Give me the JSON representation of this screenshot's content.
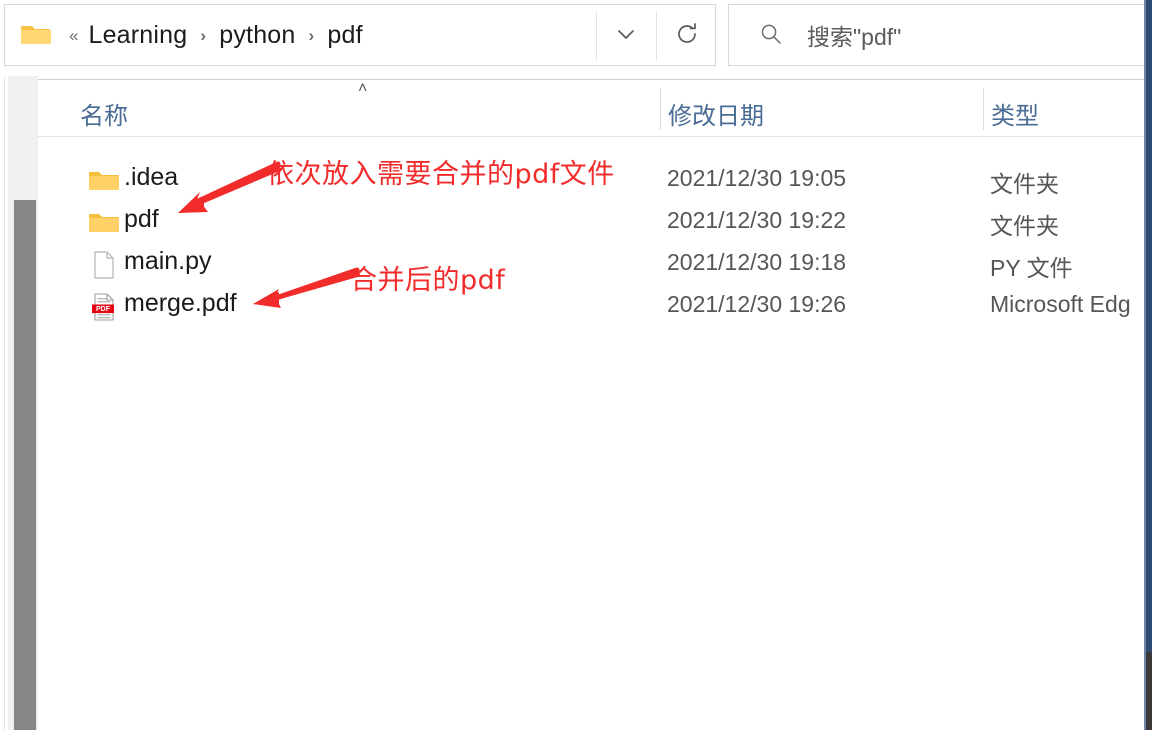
{
  "window": {
    "type": "file-explorer",
    "accent_color": "#2c4a72",
    "annotation_color": "#f22b2b"
  },
  "toolbar": {
    "folder_icon": "folder-icon",
    "overflow_symbol": "«",
    "breadcrumbs": [
      {
        "label": "Learning"
      },
      {
        "label": "python"
      },
      {
        "label": "pdf"
      }
    ],
    "breadcrumb_separator": "›",
    "dropdown_icon": "chevron-down-icon",
    "refresh_icon": "refresh-icon"
  },
  "search": {
    "icon": "search-icon",
    "placeholder": "搜索\"pdf\"",
    "value": ""
  },
  "columns": {
    "name": "名称",
    "date_modified": "修改日期",
    "type": "类型",
    "sort_indicator": "˄"
  },
  "files": [
    {
      "name": ".idea",
      "icon": "folder-icon",
      "date_modified": "2021/12/30 19:05",
      "type": "文件夹"
    },
    {
      "name": "pdf",
      "icon": "folder-icon",
      "date_modified": "2021/12/30 19:22",
      "type": "文件夹"
    },
    {
      "name": "main.py",
      "icon": "file-icon",
      "date_modified": "2021/12/30 19:18",
      "type": "PY 文件"
    },
    {
      "name": "merge.pdf",
      "icon": "pdf-file-icon",
      "date_modified": "2021/12/30 19:26",
      "type": "Microsoft Edg"
    }
  ],
  "annotations": [
    {
      "text": "依次放入需要合并的pdf文件",
      "points_to": "pdf"
    },
    {
      "text": "合并后的pdf",
      "points_to": "merge.pdf"
    }
  ],
  "pdf_icon_badge": "PDF"
}
